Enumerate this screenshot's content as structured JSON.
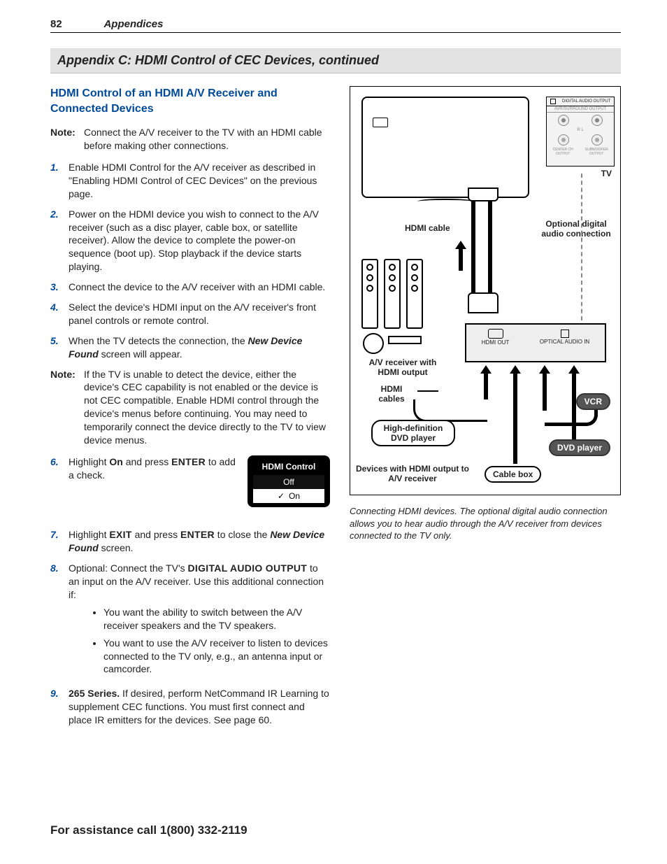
{
  "header": {
    "page_number": "82",
    "section": "Appendices"
  },
  "appendix_title": "Appendix C:  HDMI Control of CEC Devices, continued",
  "section_heading": "HDMI Control of an HDMI A/V Receiver and Connected Devices",
  "intro_note_label": "Note:",
  "intro_note": "Connect the A/V receiver to the TV with an HDMI cable before making other connections.",
  "steps": {
    "s1": "Enable HDMI Control for the A/V receiver as described in \"Enabling HDMI Control of CEC Devices\" on the previous page.",
    "s2": "Power on the HDMI device you wish to connect to the A/V receiver (such as a disc player, cable box, or satellite receiver).  Allow the device to complete the power-on sequence (boot up).  Stop playback if the device starts playing.",
    "s3": "Connect the device to the A/V receiver with an HDMI cable.",
    "s4": "Select the device's HDMI input on the A/V receiver's front panel controls or remote control.",
    "s5_pre": "When the TV detects the connection, the ",
    "s5_em": "New Device Found",
    "s5_post": " screen will appear.",
    "mid_note_label": "Note:",
    "mid_note": "If the TV is unable to detect the device, either the device's CEC capability is not enabled or the device is not CEC compatible.  Enable HDMI control through the device's menus before continuing.  You may need to temporarily connect the device directly to the TV to view device menus.",
    "s6_a": "Highlight ",
    "s6_b": "On",
    "s6_c": " and press ",
    "s6_d": "ENTER",
    "s6_e": " to add a check.",
    "s7_a": "Highlight ",
    "s7_b": "EXIT",
    "s7_c": " and press ",
    "s7_d": "ENTER",
    "s7_e": " to close the ",
    "s7_f": "New Device Found",
    "s7_g": " screen.",
    "s8_a": "Optional:  Connect the TV's ",
    "s8_b": "DIGITAL AUDIO OUTPUT",
    "s8_c": " to an input on the A/V receiver.  Use this additional connection if:",
    "s8_bullet1": "You want the ability to switch between the A/V receiver speakers and the TV speakers.",
    "s8_bullet2": "You want to use the A/V receiver to listen to devices connected to the TV only, e.g., an antenna input or camcorder.",
    "s9_a": "265 Series.",
    "s9_b": "  If desired, perform NetCommand IR Learning to supplement CEC functions.  You must first connect and place IR emitters for the devices.  See page 60."
  },
  "nums": {
    "n1": "1.",
    "n2": "2.",
    "n3": "3.",
    "n4": "4.",
    "n5": "5.",
    "n6": "6.",
    "n7": "7.",
    "n8": "8.",
    "n9": "9."
  },
  "menu": {
    "title": "HDMI Control",
    "off": "Off",
    "on": "On",
    "check": "✓"
  },
  "diagram": {
    "tv": "TV",
    "hdmi_cable": "HDMI cable",
    "optional": "Optional digital audio connection",
    "av_recv": "A/V receiver with HDMI output",
    "hdmi_cables": "HDMI cables",
    "hd_dvd": "High-definition DVD player",
    "cable_box": "Cable box",
    "vcr": "VCR",
    "dvd": "DVD player",
    "devices_with": "Devices with HDMI output to A/V receiver",
    "hdmi_out": "HDMI OUT",
    "optical": "OPTICAL AUDIO IN",
    "dao": "DIGITAL AUDIO OUTPUT",
    "surround": "AVR/SURROUND OUTPUT",
    "lr": "R   L",
    "center": "CENTER CH OUTPUT",
    "sub": "SUBWOOFER OUTPUT"
  },
  "caption": "Connecting HDMI devices.  The optional digital audio connection allows you to hear audio through the A/V receiver from devices connected to the TV only.",
  "footer": "For assistance call 1(800) 332-2119"
}
